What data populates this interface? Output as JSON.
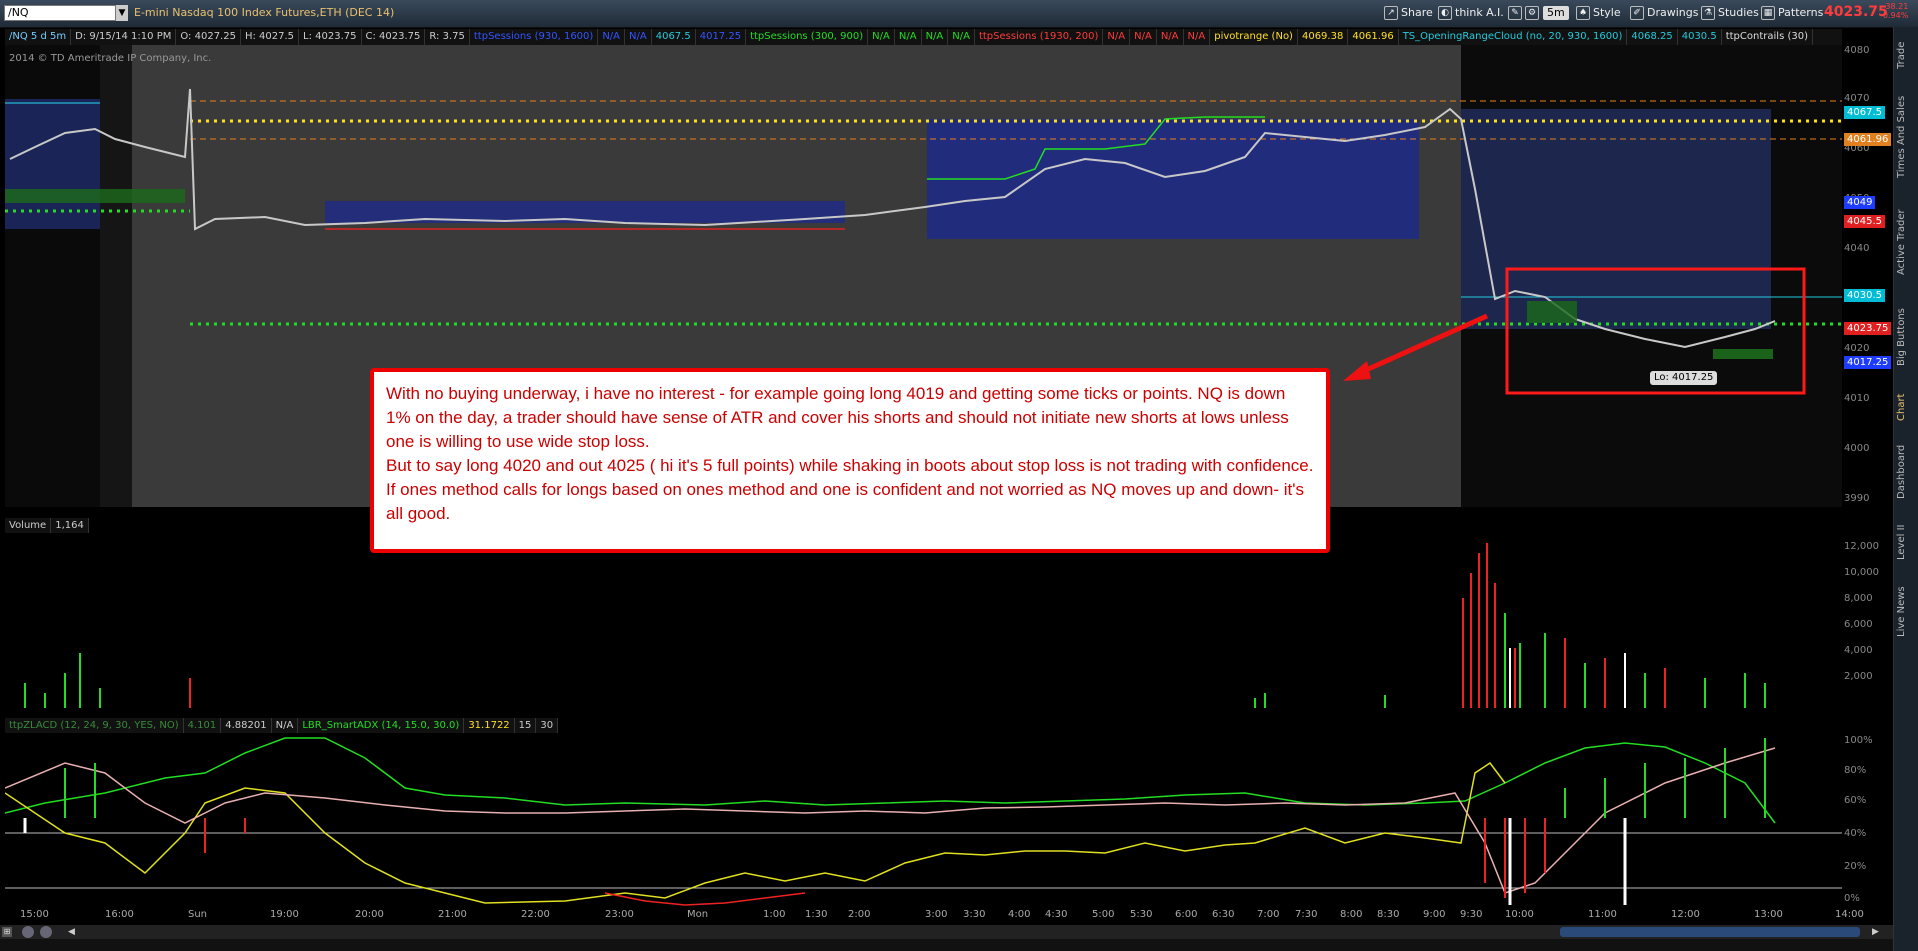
{
  "symbol": "/NQ",
  "description": "E-mini Nasdaq 100 Index Futures,ETH (DEC 14)",
  "toolbar": {
    "share": "Share",
    "think": "think A.I.",
    "aggregation": "5m",
    "style": "Style",
    "drawings": "Drawings",
    "studies": "Studies",
    "patterns": "Patterns"
  },
  "quote": {
    "last": "4023.75",
    "change": "-38.21",
    "change_pct": "-0.94%"
  },
  "info": {
    "period": "/NQ 5 d 5m",
    "date": "D: 9/15/14 1:10 PM",
    "open": "O: 4027.25",
    "high": "H: 4027.5",
    "low": "L: 4023.75",
    "close": "C: 4023.75",
    "range": "R: 3.75",
    "study1": "ttpSessions (930, 1600)",
    "s1a": "N/A",
    "s1b": "N/A",
    "s1c": "4067.5",
    "s1d": "4017.25",
    "study2": "ttpSessions (300, 900)",
    "s2a": "N/A",
    "s2b": "N/A",
    "s2c": "N/A",
    "s2d": "N/A",
    "study3": "ttpSessions (1930, 200)",
    "s3a": "N/A",
    "s3b": "N/A",
    "s3c": "N/A",
    "s3d": "N/A",
    "study4": "pivotrange (No)",
    "s4a": "4069.38",
    "s4b": "4061.96",
    "study5": "TS_OpeningRangeCloud (no, 20, 930, 1600)",
    "s5a": "4068.25",
    "s5b": "4030.5",
    "study6": "ttpContrails (30)"
  },
  "copyright": "2014 © TD Ameritrade IP Company, Inc.",
  "y_axis": {
    "ticks": [
      "4080",
      "4070",
      "4060",
      "4050",
      "4040",
      "4030",
      "4020",
      "4010",
      "4000",
      "3990"
    ],
    "badges": [
      {
        "text": "4067.5",
        "bg": "#00bcd4"
      },
      {
        "text": "4061.96",
        "bg": "#e08020"
      },
      {
        "text": "4049",
        "bg": "#1e3cff"
      },
      {
        "text": "4045.5",
        "bg": "#e02020"
      },
      {
        "text": "4030.5",
        "bg": "#00bcd4"
      },
      {
        "text": "4023.75",
        "bg": "#e02020"
      },
      {
        "text": "4017.25",
        "bg": "#1e3cff"
      }
    ]
  },
  "lo_label": "Lo: 4017.25",
  "annotation": {
    "lines": [
      "With no buying underway, i have no interest - for example going long 4019 and getting some ticks or points. NQ is down 1% on the day, a trader should have sense of ATR and cover his shorts and should not initiate new shorts at lows unless one is willing to use wide stop loss.",
      "But to say long 4020 and out 4025 ( hi it's 5 full points) while shaking in boots about stop loss is not trading with confidence.  If ones method calls for longs based on ones method and one is confident and not worried as NQ moves up and down- it's all good."
    ]
  },
  "volume": {
    "label": "Volume",
    "value": "1,164",
    "ticks": [
      "12,000",
      "10,000",
      "8,000",
      "6,000",
      "4,000",
      "2,000"
    ]
  },
  "indicator": {
    "name": "ttpZLACD (12, 24, 9, 30, YES, NO)",
    "v1": "4.101",
    "v2": "4.88201",
    "v3": "N/A",
    "adx": "LBR_SmartADX (14, 15.0, 30.0)",
    "adx_v": "31.1722",
    "p1": "15",
    "p2": "30",
    "ticks": [
      "100%",
      "80%",
      "60%",
      "40%",
      "20%",
      "0%"
    ]
  },
  "x_axis": [
    "15:00",
    "16:00",
    "Sun",
    "19:00",
    "20:00",
    "21:00",
    "22:00",
    "23:00",
    "Mon",
    "1:00",
    "1:30",
    "2:00",
    "3:00",
    "3:30",
    "4:00",
    "4:30",
    "5:00",
    "5:30",
    "6:00",
    "6:30",
    "7:00",
    "7:30",
    "8:00",
    "8:30",
    "9:00",
    "9:30",
    "10:00",
    "11:00",
    "12:00",
    "13:00",
    "14:00"
  ],
  "sidebar_tabs": [
    "Trade",
    "Times And Sales",
    "Active Trader",
    "Big Buttons",
    "Chart",
    "Dashboard",
    "Level II",
    "Live News"
  ],
  "colors": {
    "accent": "#e8c070",
    "negative": "#ff3b3b",
    "positive": "#22dd22"
  }
}
